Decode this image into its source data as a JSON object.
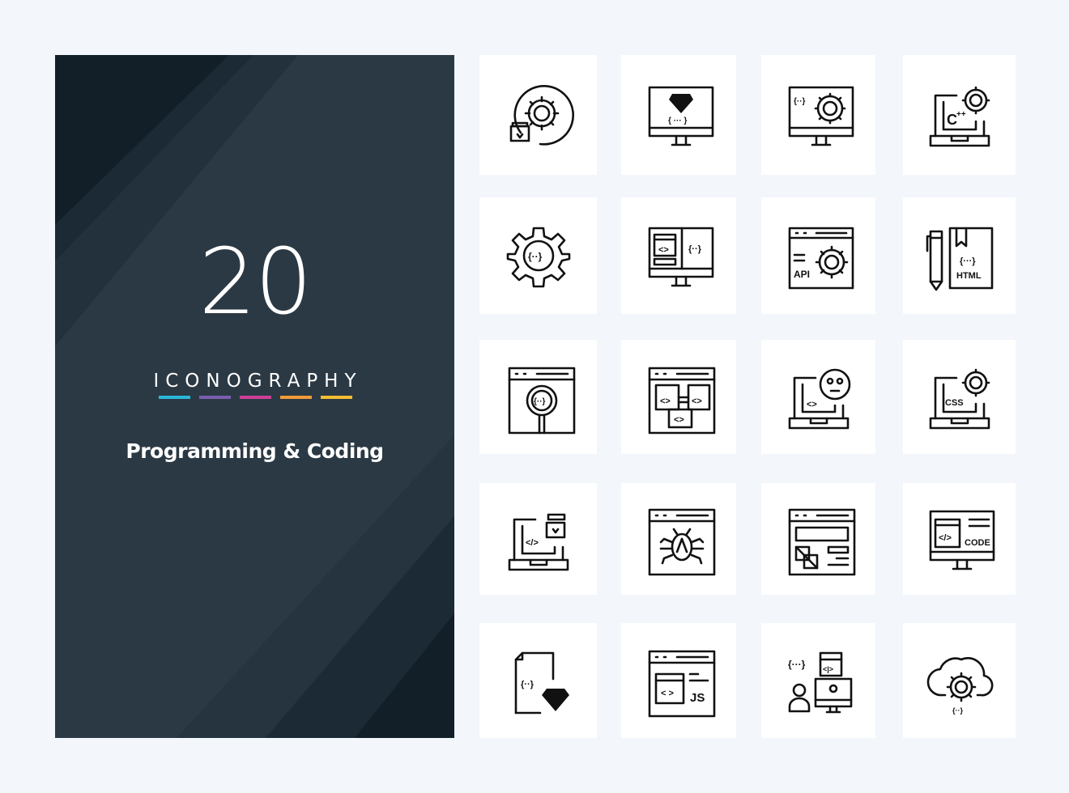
{
  "cover": {
    "count": "20",
    "label": "ICONOGRAPHY",
    "title": "Programming & Coding",
    "accent_bars": [
      "#29b6d9",
      "#7a5fb0",
      "#cc3f96",
      "#f19a3a",
      "#f4bd32"
    ],
    "panel_color": "#2b3944",
    "panel_dark_color": "#121f28"
  },
  "icons": [
    {
      "name": "developer-gear-icon"
    },
    {
      "name": "monitor-diamond-code-icon",
      "text": "{ ··· }"
    },
    {
      "name": "monitor-code-gear-icon",
      "text": "{··}"
    },
    {
      "name": "laptop-cpp-gear-icon",
      "text": "C++"
    },
    {
      "name": "gear-code-icon",
      "text": "{··}"
    },
    {
      "name": "monitor-split-code-icon",
      "text": "{··}"
    },
    {
      "name": "browser-api-gear-icon",
      "text": "API"
    },
    {
      "name": "pen-html-book-icon",
      "text": "HTML"
    },
    {
      "name": "browser-code-search-icon",
      "text": "{··}"
    },
    {
      "name": "browser-code-blocks-icon"
    },
    {
      "name": "laptop-code-face-icon"
    },
    {
      "name": "laptop-css-gear-icon",
      "text": "CSS"
    },
    {
      "name": "laptop-developer-code-icon",
      "text": "</>"
    },
    {
      "name": "browser-bug-icon"
    },
    {
      "name": "browser-layout-icon"
    },
    {
      "name": "monitor-code-label-icon",
      "text": "CODE"
    },
    {
      "name": "file-code-diamond-icon",
      "text": "{··}"
    },
    {
      "name": "browser-js-icon",
      "text": "JS"
    },
    {
      "name": "developer-monitor-code-icon",
      "text": "{···}"
    },
    {
      "name": "cloud-gear-code-icon"
    }
  ]
}
